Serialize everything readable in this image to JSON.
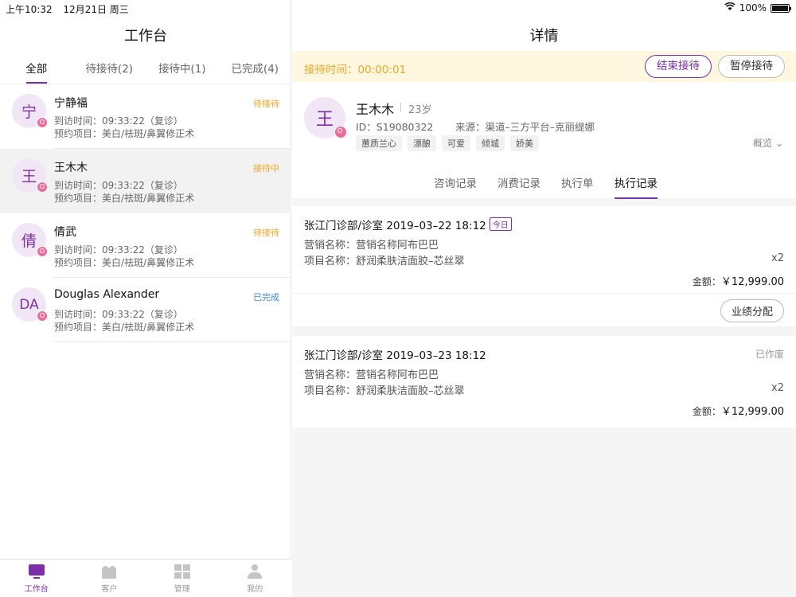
{
  "status_bar": {
    "time": "上午10:32",
    "date": "12月21日 周三",
    "battery": "100%"
  },
  "left": {
    "title": "工作台",
    "tabs": [
      {
        "label": "全部"
      },
      {
        "label": "待接待(2)"
      },
      {
        "label": "接待中(1)"
      },
      {
        "label": "已完成(4)"
      }
    ],
    "items": [
      {
        "avatar": "宁",
        "name": "宁静福",
        "status": "待接待",
        "visit": "到访时间：09:33:22（复诊）",
        "project": "预约项目：美白/祛斑/鼻翼修正术"
      },
      {
        "avatar": "王",
        "name": "王木木",
        "status": "接待中",
        "visit": "到访时间：09:33:22（复诊）",
        "project": "预约项目：美白/祛斑/鼻翼修正术"
      },
      {
        "avatar": "倩",
        "name": "倩武",
        "status": "待接待",
        "visit": "到访时间：09:33:22（复诊）",
        "project": "预约项目：美白/祛斑/鼻翼修正术"
      },
      {
        "avatar": "DA",
        "name": "Douglas Alexander",
        "status": "已完成",
        "visit": "到访时间：09:33:22（复诊）",
        "project": "预约项目：美白/祛斑/鼻翼修正术"
      }
    ],
    "nav": [
      {
        "label": "工作台",
        "icon": "monitor-icon"
      },
      {
        "label": "客户",
        "icon": "users-icon"
      },
      {
        "label": "管理",
        "icon": "grid-icon"
      },
      {
        "label": "我的",
        "icon": "user-icon"
      }
    ]
  },
  "right": {
    "title": "详情",
    "timer_label": "接待时间：00:00:01",
    "end_button": "结束接待",
    "pause_button": "暂停接待",
    "profile": {
      "avatar": "王",
      "name": "王木木",
      "age": "23岁",
      "id": "ID：S19080322",
      "source": "来源：渠道–三方平台–克丽缇娜",
      "tags": [
        "蕙质兰心",
        "漂酿",
        "可爱",
        "倾城",
        "娇美"
      ],
      "overview": "概览"
    },
    "sub_tabs": [
      {
        "label": "咨询记录"
      },
      {
        "label": "消费记录"
      },
      {
        "label": "执行单"
      },
      {
        "label": "执行记录"
      }
    ],
    "records": [
      {
        "header": "张江门诊部/诊室   2019–03–22 18:12",
        "badge": "今日",
        "marketing": "营销名称：营销名称阿布巴巴",
        "project": "项目名称：舒润柔肤洁面胶–芯丝翠",
        "qty": "x2",
        "amount_label": "金额：",
        "amount": "￥12,999.00",
        "button": "业绩分配"
      },
      {
        "header": "张江门诊部/诊室   2019–03–23 18:12",
        "status": "已作废",
        "marketing": "营销名称：营销名称阿布巴巴",
        "project": "项目名称：舒润柔肤洁面胶–芯丝翠",
        "qty": "x2",
        "amount_label": "金额：",
        "amount": "￥12,999.00"
      }
    ]
  }
}
